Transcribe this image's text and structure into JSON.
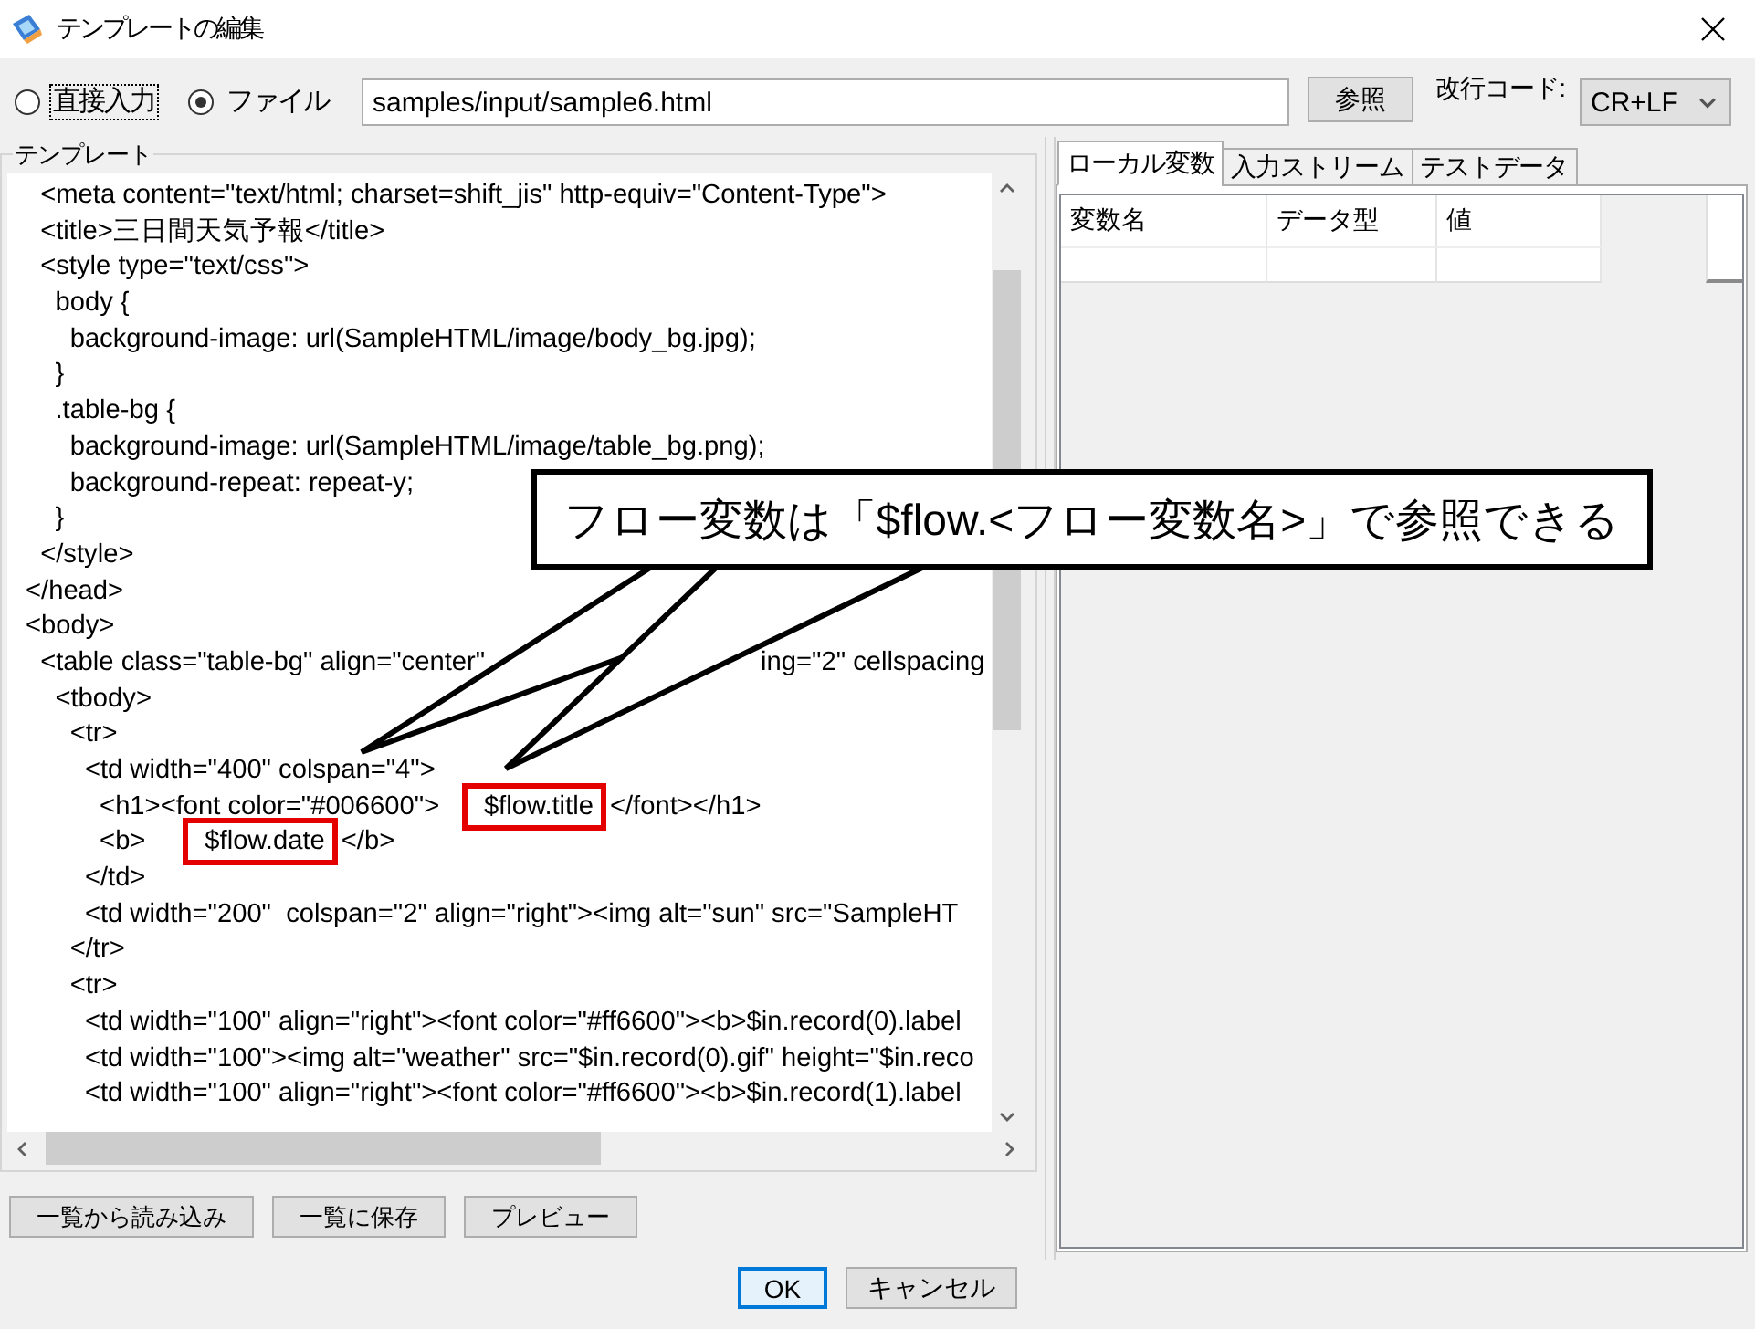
{
  "window": {
    "title": "テンプレートの編集"
  },
  "source": {
    "options": [
      {
        "label": "直接入力",
        "selected": false,
        "focused": true
      },
      {
        "label": "ファイル",
        "selected": true,
        "focused": false
      }
    ],
    "file_path": "samples/input/sample6.html",
    "browse_button": "参照",
    "line_ending_label": "改行コード:",
    "line_ending": "CR+LF"
  },
  "template": {
    "title": "テンプレート",
    "lines": [
      {
        "text": "  <meta content=\"text/html; charset=shift_jis\" http-equiv=\"Content-Type\">"
      },
      {
        "text": "  <title>三日間天気予報</title>"
      },
      {
        "text": "  <style type=\"text/css\">"
      },
      {
        "text": "    body {"
      },
      {
        "text": "      background-image: url(SampleHTML/image/body_bg.jpg);"
      },
      {
        "text": "    }"
      },
      {
        "text": "    .table-bg {"
      },
      {
        "text": "      background-image: url(SampleHTML/image/table_bg.png);"
      },
      {
        "text": "      background-repeat: repeat-y;"
      },
      {
        "text": "    }"
      },
      {
        "text": "  </style>"
      },
      {
        "text": "</head>"
      },
      {
        "text": "<body>"
      },
      {
        "parts": [
          {
            "kind": "code",
            "text": "  <table class=\"table-bg\" align=\"center\""
          },
          {
            "kind": "covered"
          },
          {
            "kind": "code",
            "text": "ing=\"2\" cellspacing"
          }
        ]
      },
      {
        "text": "    <tbody>"
      },
      {
        "text": "      <tr>"
      },
      {
        "text": "        <td width=\"400\" colspan=\"4\">"
      },
      {
        "parts": [
          {
            "kind": "code",
            "text": "          <h1><font color=\"#006600\">      "
          },
          {
            "kind": "highlight",
            "text": "$flow.title"
          },
          {
            "kind": "code",
            "text": "</font></h1>"
          }
        ]
      },
      {
        "parts": [
          {
            "kind": "code",
            "text": "          <b>        "
          },
          {
            "kind": "highlight",
            "text": "$flow.date"
          },
          {
            "kind": "code",
            "text": "</b>"
          }
        ]
      },
      {
        "text": "        </td>"
      },
      {
        "text": "        <td width=\"200\"  colspan=\"2\" align=\"right\"><img alt=\"sun\" src=\"SampleHT"
      },
      {
        "text": "      </tr>"
      },
      {
        "text": "      <tr>"
      },
      {
        "text": "        <td width=\"100\" align=\"right\"><font color=\"#ff6600\"><b>$in.record(0).label"
      },
      {
        "text": "        <td width=\"100\"><img alt=\"weather\" src=\"$in.record(0).gif\" height=\"$in.reco"
      },
      {
        "text": "        <td width=\"100\" align=\"right\"><font color=\"#ff6600\"><b>$in.record(1).label"
      }
    ],
    "buttons": [
      "一覧から読み込み",
      "一覧に保存",
      "プレビュー"
    ]
  },
  "variables": {
    "tabs": [
      {
        "label": "ローカル変数",
        "selected": true
      },
      {
        "label": "入力ストリーム",
        "selected": false
      },
      {
        "label": "テストデータ",
        "selected": false
      }
    ],
    "columns": [
      "変数名",
      "データ型",
      "値"
    ]
  },
  "buttons": [
    {
      "label": "OK",
      "default": true
    },
    {
      "label": "キャンセル",
      "default": false
    }
  ],
  "callout": {
    "text": "フロー変数は「$flow.<フロー変数名>」で参照できる"
  }
}
